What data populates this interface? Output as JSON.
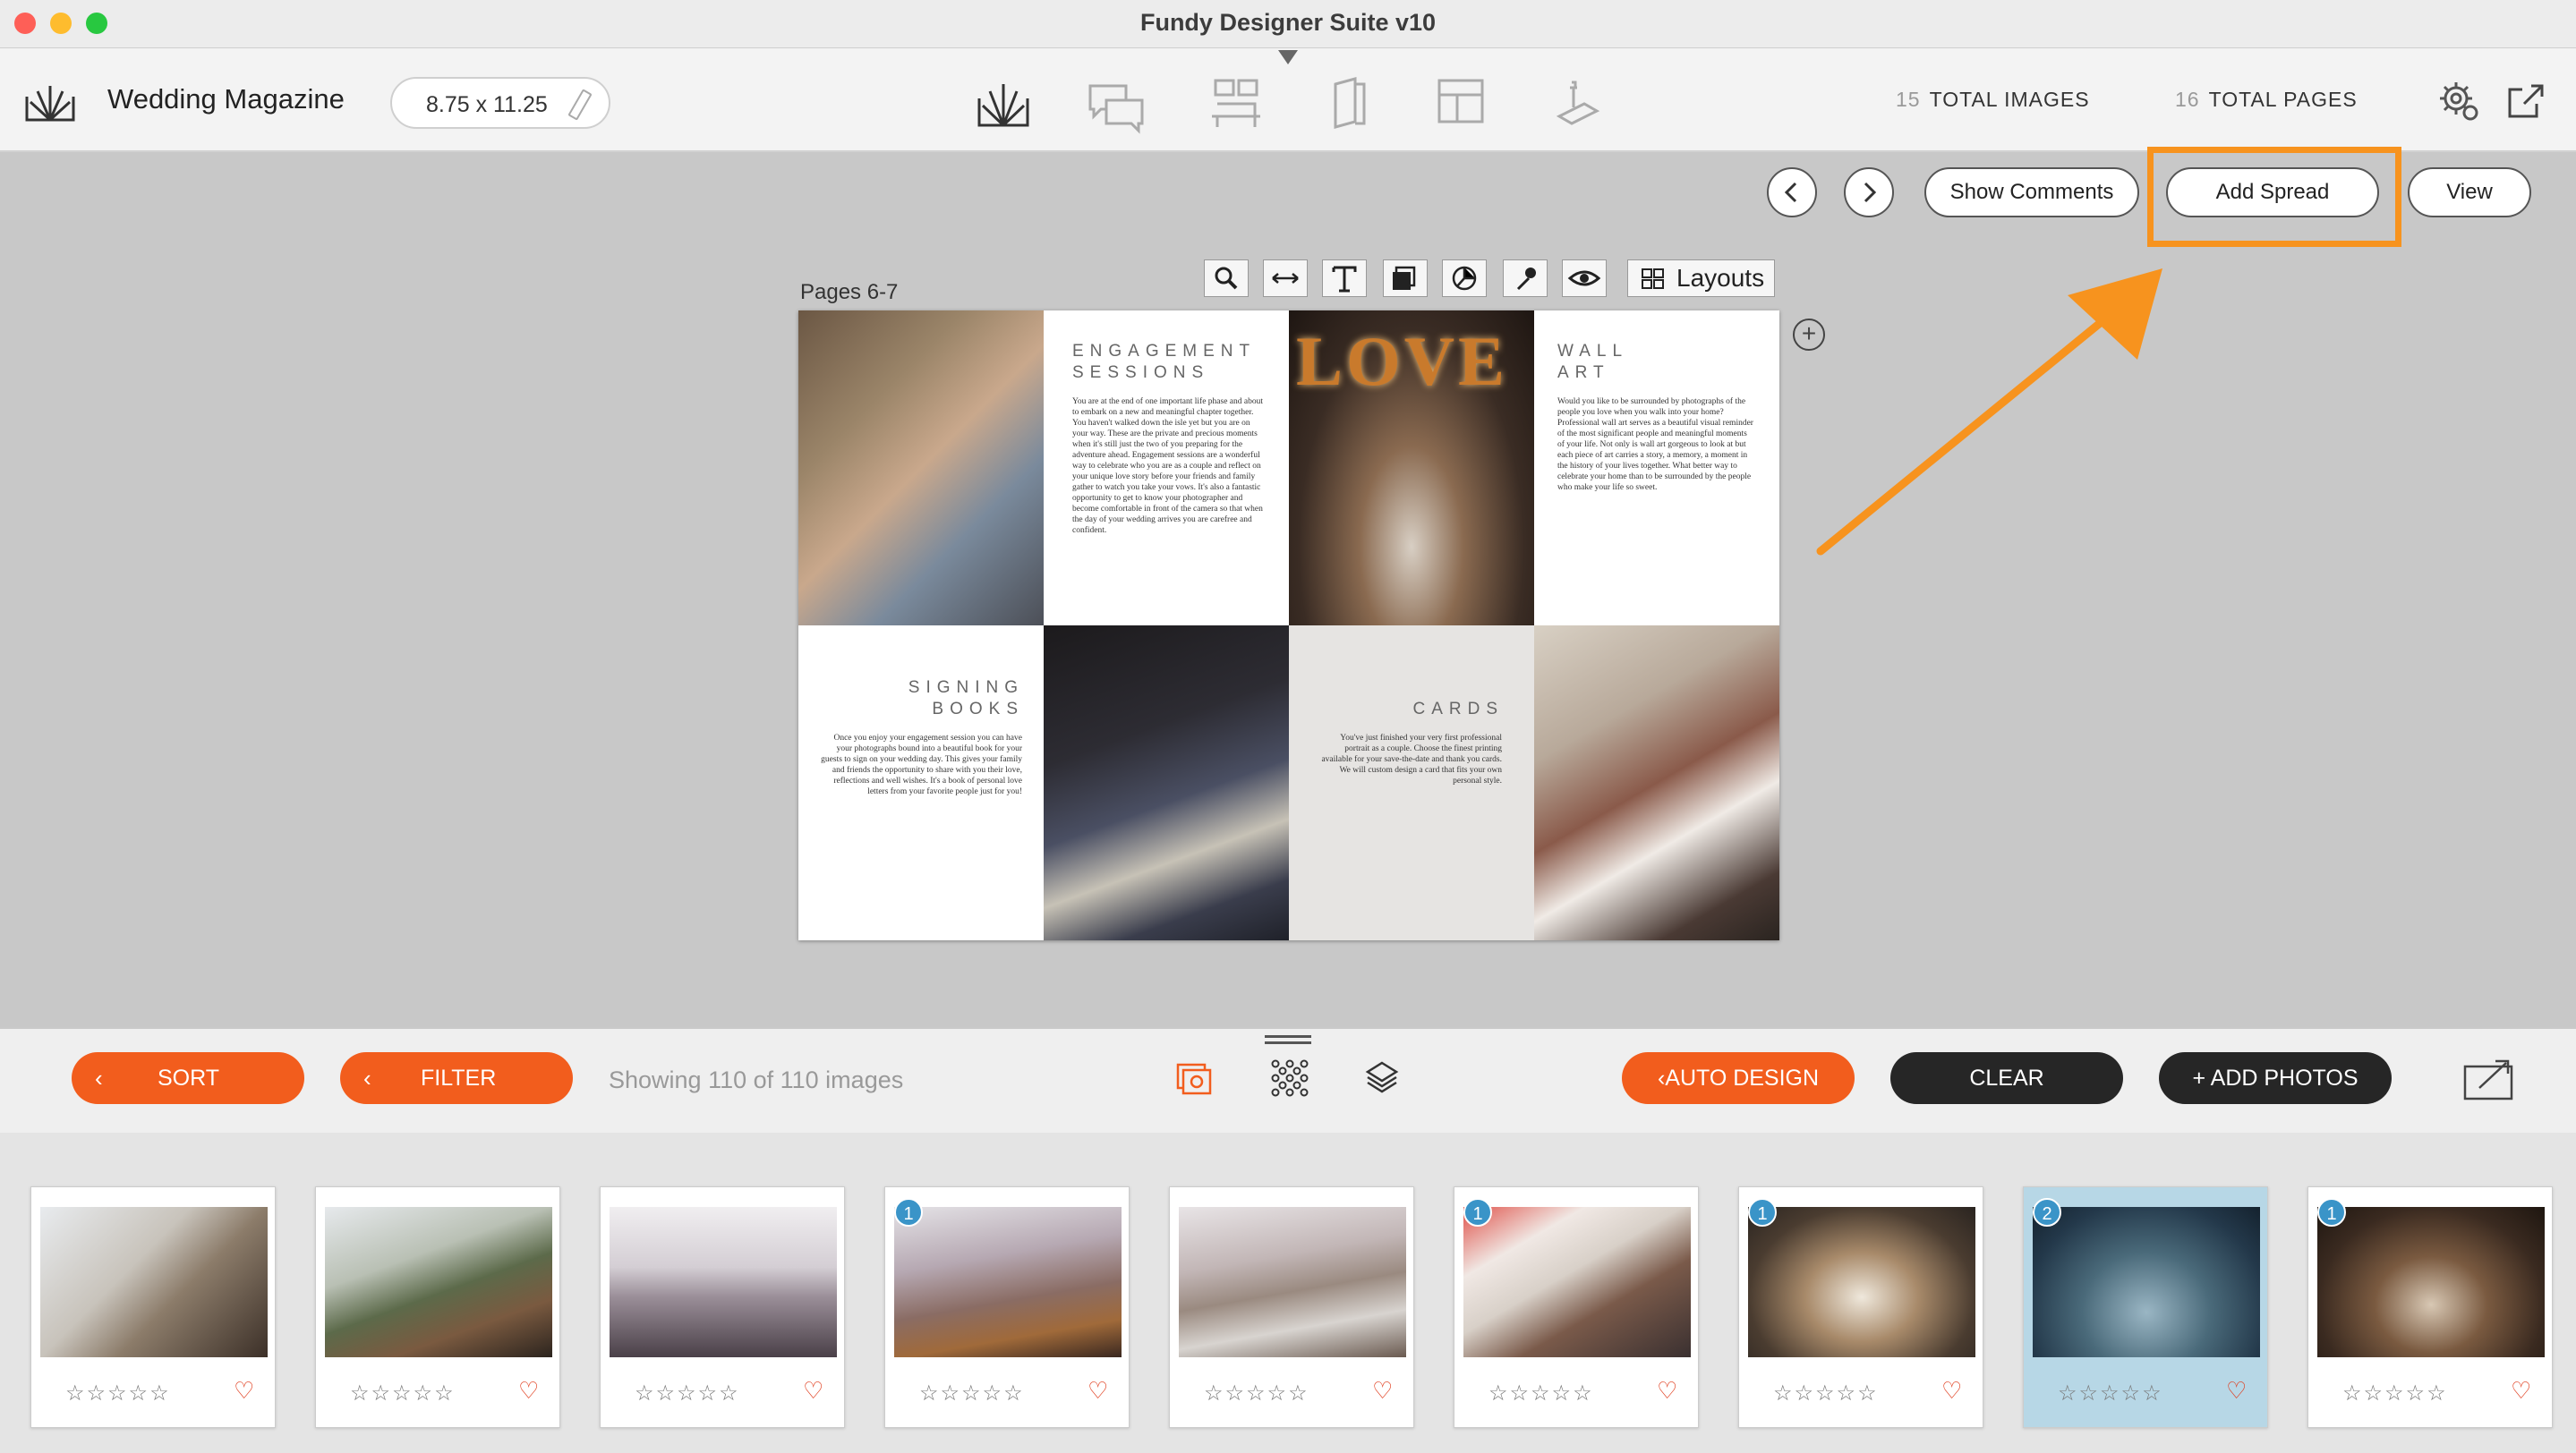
{
  "window": {
    "title": "Fundy Designer Suite v10"
  },
  "toolbar": {
    "app_name": "Wedding Magazine",
    "page_size": "8.75 x 11.25",
    "total_images": {
      "count": "15",
      "label": "TOTAL IMAGES"
    },
    "total_pages": {
      "count": "16",
      "label": "TOTAL PAGES"
    }
  },
  "actions": {
    "show_comments": "Show Comments",
    "add_spread": "Add Spread",
    "view": "View"
  },
  "editor": {
    "pages_label": "Pages 6-7",
    "layouts_label": "Layouts"
  },
  "spread_text": {
    "engagement_title": "ENGAGEMENT SESSIONS",
    "engagement_body": "You are at the end of one important life phase and about to embark on a new and meaningful chapter together. You haven't walked down the isle yet but you are on your way. These are the private and precious moments when it's still just the two of you preparing for the adventure ahead. Engagement sessions are a wonderful way to celebrate who you are as a couple and reflect on your unique love story before your friends and family gather to watch you take your vows. It's also a fantastic opportunity to get to know your photographer and become comfortable in front of the camera so that when the day of your wedding arrives you are carefree and confident.",
    "wallart_title": "WALL ART",
    "wallart_body": "Would you like to be surrounded by photographs of the people you love when you walk into your home? Professional wall art serves as a beautiful visual reminder of the most significant people and meaningful moments of your life. Not only is wall art gorgeous to look at but each piece of art carries a story, a memory, a moment in the history of your lives together. What better way to celebrate your home than to be surrounded by the people who make your life so sweet.",
    "signing_title": "SIGNING BOOKS",
    "signing_body": "Once you enjoy your engagement session you can have your photographs bound into a beautiful book for your guests to sign on your wedding day. This gives your family and friends the opportunity to share with you their love, reflections and well wishes. It's a book of personal love letters from your favorite people just for you!",
    "cards_title": "CARDS",
    "cards_body": "You've just finished your very first professional portrait as a couple. Choose the finest printing available for your save-the-date and thank you cards. We will custom design a card that fits your own personal style."
  },
  "bottom": {
    "sort": "SORT",
    "filter": "FILTER",
    "showing": "Showing 110 of 110 images",
    "auto_design": "AUTO DESIGN",
    "clear": "CLEAR",
    "add_photos": "+ ADD PHOTOS"
  },
  "thumbnails": [
    {
      "badge": "",
      "stars": "☆☆☆☆☆",
      "heart": "♡"
    },
    {
      "badge": "",
      "stars": "☆☆☆☆☆",
      "heart": "♡"
    },
    {
      "badge": "",
      "stars": "☆☆☆☆☆",
      "heart": "♡"
    },
    {
      "badge": "1",
      "stars": "☆☆☆☆☆",
      "heart": "♡"
    },
    {
      "badge": "",
      "stars": "☆☆☆☆☆",
      "heart": "♡"
    },
    {
      "badge": "1",
      "stars": "☆☆☆☆☆",
      "heart": "♡"
    },
    {
      "badge": "1",
      "stars": "☆☆☆☆☆",
      "heart": "♡"
    },
    {
      "badge": "2",
      "stars": "☆☆☆☆☆",
      "heart": "♡"
    },
    {
      "badge": "1",
      "stars": "☆☆☆☆☆",
      "heart": "♡"
    }
  ],
  "colors": {
    "accent": "#f25d1d",
    "highlight": "#f7931e",
    "badge": "#3a94c8",
    "dark_button": "#262626"
  }
}
